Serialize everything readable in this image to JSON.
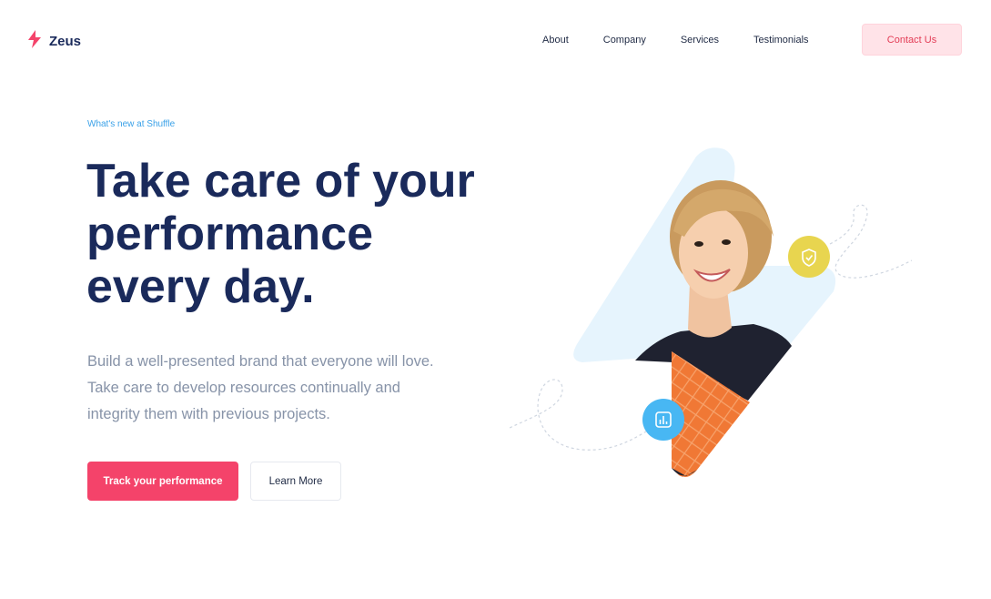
{
  "header": {
    "brand": "Zeus",
    "brand_icon": "lightning-bolt-icon",
    "nav": [
      "About",
      "Company",
      "Services",
      "Testimonials"
    ],
    "contact_label": "Contact Us"
  },
  "hero": {
    "eyebrow": "What's new at Shuffle",
    "headline_lines": [
      "Take care of your",
      "performance",
      "every day."
    ],
    "description_lines": [
      "Build a well-presented brand that everyone will love.",
      "Take care to develop resources continually and",
      "integrity them with previous projects."
    ],
    "primary_cta": "Track your performance",
    "secondary_cta": "Learn More"
  },
  "illustration": {
    "badge_top_icon": "shield-check-icon",
    "badge_bottom_icon": "bar-chart-icon"
  },
  "colors": {
    "brand": "#1a2a5b",
    "accent": "#f4436a",
    "eyebrow": "#3aa1e8",
    "text_muted": "#8793a8",
    "contact_bg": "#ffe3e8",
    "badge_yellow": "#e8d54f",
    "badge_blue": "#48b7f3",
    "shape_light": "#e6f4fd"
  }
}
